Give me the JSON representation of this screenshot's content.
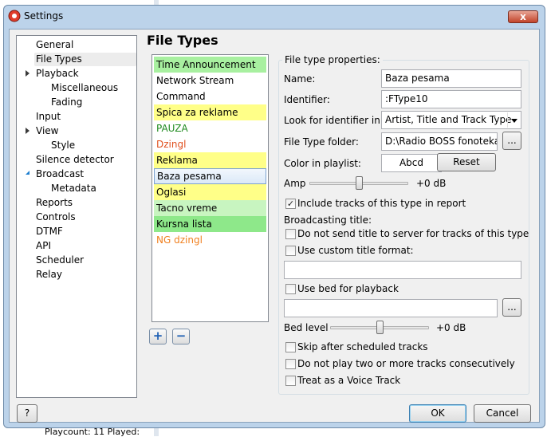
{
  "background": {
    "status_text": "Playcount: 11  Played:"
  },
  "window": {
    "title": "Settings",
    "close_glyph": "x"
  },
  "nav": {
    "items": [
      {
        "label": "General"
      },
      {
        "label": "File Types"
      },
      {
        "label": "Playback"
      },
      {
        "label": "Miscellaneous"
      },
      {
        "label": "Fading"
      },
      {
        "label": "Input"
      },
      {
        "label": "View"
      },
      {
        "label": "Style"
      },
      {
        "label": "Silence detector"
      },
      {
        "label": "Broadcast"
      },
      {
        "label": "Metadata"
      },
      {
        "label": "Reports"
      },
      {
        "label": "Controls"
      },
      {
        "label": "DTMF"
      },
      {
        "label": "API"
      },
      {
        "label": "Scheduler"
      },
      {
        "label": "Relay"
      }
    ]
  },
  "section_title": "File Types",
  "file_types": {
    "items": [
      {
        "label": "Time Announcement",
        "bg": "#a8f0a0",
        "fg": "#000000"
      },
      {
        "label": "Network Stream",
        "bg": "#ffffff",
        "fg": "#000000"
      },
      {
        "label": "Command",
        "bg": "#ffffff",
        "fg": "#000000"
      },
      {
        "label": "Spica za reklame",
        "bg": "#ffff88",
        "fg": "#000000"
      },
      {
        "label": "PAUZA",
        "bg": "#ffffff",
        "fg": "#1e8a1e"
      },
      {
        "label": "Dzingl",
        "bg": "#ffffff",
        "fg": "#e0501e"
      },
      {
        "label": "Reklama",
        "bg": "#ffff88",
        "fg": "#000000"
      },
      {
        "label": "Baza pesama",
        "bg": "#dbe9f8",
        "fg": "#000000"
      },
      {
        "label": "Oglasi",
        "bg": "#ffff88",
        "fg": "#000000"
      },
      {
        "label": "Tacno vreme",
        "bg": "#c8f5c0",
        "fg": "#000000"
      },
      {
        "label": "Kursna lista",
        "bg": "#8ee88a",
        "fg": "#000000"
      },
      {
        "label": "NG dzingl",
        "bg": "#ffffff",
        "fg": "#f08020"
      }
    ],
    "add_glyph": "+",
    "remove_glyph": "−"
  },
  "props": {
    "legend": "File type properties:",
    "name_label": "Name:",
    "name_value": "Baza pesama",
    "identifier_label": "Identifier:",
    "identifier_value": ":FType10",
    "look_label": "Look for identifier in:",
    "look_value": "Artist, Title and Track Type",
    "folder_label": "File Type folder:",
    "folder_value": "D:\\Radio BOSS fonoteka",
    "browse_label": "...",
    "color_label": "Color in playlist:",
    "color_sample": "Abcd",
    "reset_label": "Reset",
    "amp_label": "Amp",
    "amp_value": "+0 dB",
    "amp_level": 0.5,
    "include_reports_label": "Include tracks of this type in report",
    "include_reports_checked": true,
    "broadcasting_title_label": "Broadcasting title:",
    "no_send_title_label": "Do not send title to server for tracks of this type",
    "no_send_title_checked": false,
    "custom_title_label": "Use custom title format:",
    "custom_title_checked": false,
    "custom_title_value": "",
    "use_bed_label": "Use bed for playback",
    "use_bed_checked": false,
    "bed_value": "",
    "bed_browse_label": "...",
    "bed_level_label": "Bed level",
    "bed_level_value": "+0 dB",
    "bed_level": 0.5,
    "skip_after_label": "Skip after scheduled tracks",
    "skip_after_checked": false,
    "no_two_label": "Do not play two or more tracks consecutively",
    "no_two_checked": false,
    "voice_track_label": "Treat as a Voice Track",
    "voice_track_checked": false
  },
  "footer": {
    "help_label": "?",
    "ok_label": "OK",
    "cancel_label": "Cancel"
  }
}
